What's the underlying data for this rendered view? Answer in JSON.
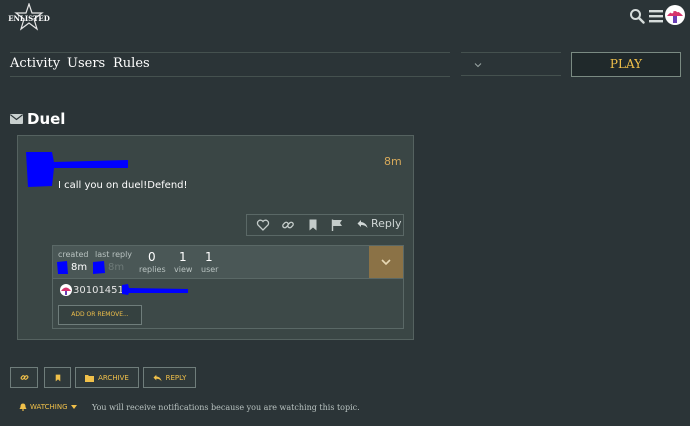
{
  "header": {
    "logo_text": "ENLISTED",
    "search_icon": "search-icon",
    "menu_icon": "hamburger-icon",
    "avatar_icon": "mushroom-avatar"
  },
  "nav": {
    "items": [
      {
        "label": "Activity"
      },
      {
        "label": "Users"
      },
      {
        "label": "Rules"
      }
    ],
    "play_label": "PLAY"
  },
  "topic": {
    "title": "Duel"
  },
  "post": {
    "time": "8m",
    "body": "I call you on duel!Defend!",
    "reply_label": "Reply"
  },
  "topic_map": {
    "created_label": "created",
    "created_value": "8m",
    "last_reply_label": "last reply",
    "last_reply_value": "8m",
    "replies_count": "0",
    "replies_label": "replies",
    "views_count": "1",
    "views_label": "view",
    "users_count": "1",
    "users_label": "user",
    "participant_name": "30101451",
    "add_remove_label": "ADD OR REMOVE..."
  },
  "footer": {
    "archive_label": "ARCHIVE",
    "reply_label": "REPLY",
    "watching_label": "WATCHING",
    "watching_desc": "You will receive notifications because you are watching this topic."
  },
  "colors": {
    "background": "#2b3437",
    "accent": "#f0c04a",
    "redaction": "#0000ff"
  }
}
